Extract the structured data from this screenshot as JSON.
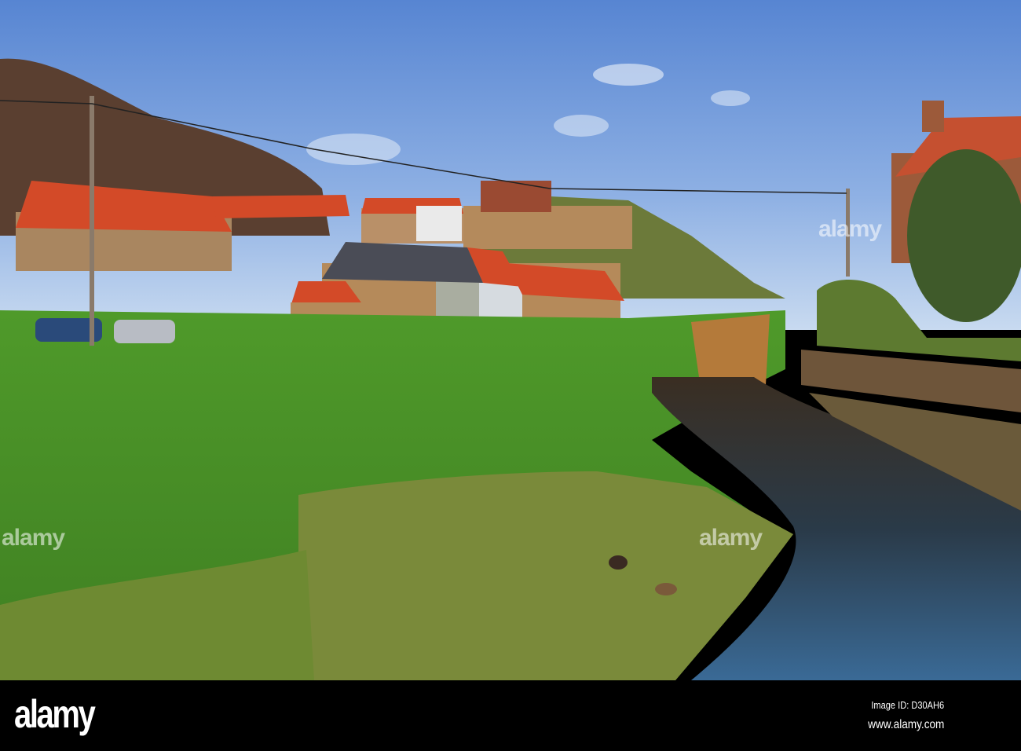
{
  "photo": {
    "subject": "village-stream-scene",
    "colors": {
      "sky_top": "#5b8ad4",
      "sky_horizon": "#c3d6ef",
      "grass": "#4f9a2a",
      "roof": "#d8492a",
      "stone": "#b58a5a",
      "water": "#1e3344"
    }
  },
  "watermark": {
    "text": "alamy"
  },
  "footer": {
    "logo": "alamy",
    "image_id": "Image ID: D30AH6",
    "url": "www.alamy.com"
  }
}
